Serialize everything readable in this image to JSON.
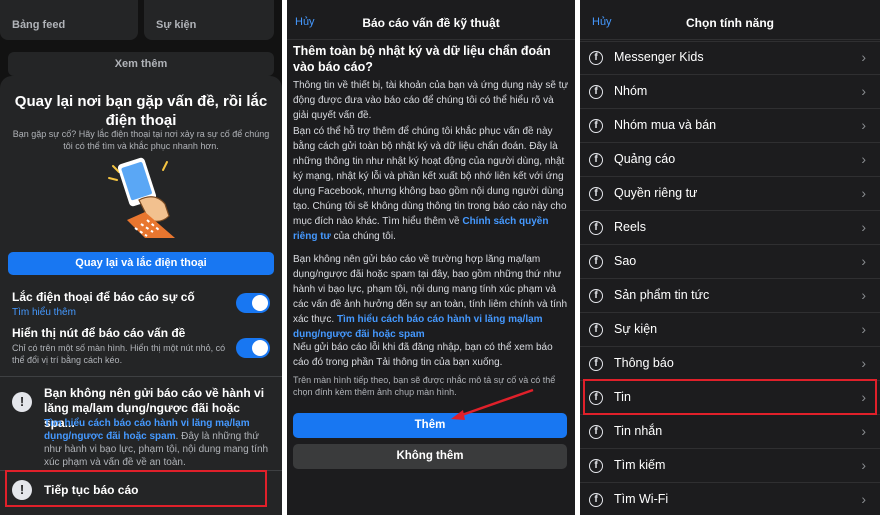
{
  "panel1": {
    "bg_tiles": [
      "Bảng feed",
      "Sự kiện"
    ],
    "bg_see_more": "Xem thêm",
    "title": "Quay lại nơi bạn gặp vấn đề, rồi lắc điện thoại",
    "subtitle": "Bạn gặp sự cố? Hãy lắc điện thoại tại nơi xảy ra sự cố để chúng tôi có thể tìm và khắc phục nhanh hơn.",
    "shake_button": "Quay lại và lắc điện thoại",
    "toggle1": {
      "label": "Lắc điện thoại để báo cáo sự cố",
      "link": "Tìm hiểu thêm",
      "on": true
    },
    "toggle2": {
      "label": "Hiển thị nút để báo cáo vấn đề",
      "desc": "Chỉ có trên một số màn hình. Hiển thị một nút nhỏ, có thể đổi vị trí bằng cách kéo.",
      "on": true
    },
    "warning": {
      "title": "Bạn không nên gửi báo cáo về hành vi lăng mạ/lạm dụng/ngược đãi hoặc spa...",
      "link": "Tìm hiểu cách báo cáo hành vi lăng mạ/lạm dụng/ngược đãi hoặc spam",
      "body": ". Đây là những thứ như hành vi bạo lực, phạm tội, nội dung mang tính xúc phạm và vấn đề về an toàn."
    },
    "continue_label": "Tiếp tục báo cáo"
  },
  "panel2": {
    "cancel": "Hủy",
    "title": "Báo cáo vấn đề kỹ thuật",
    "heading": "Thêm toàn bộ nhật ký và dữ liệu chẩn đoán vào báo cáo?",
    "para1": "Thông tin về thiết bị, tài khoản của bạn và ứng dụng này sẽ tự động được đưa vào báo cáo để chúng tôi có thể hiểu rõ và giải quyết vấn đề.",
    "para2": "Bạn có thể hỗ trợ thêm để chúng tôi khắc phục vấn đề này bằng cách gửi toàn bộ nhật ký và dữ liệu chẩn đoán. Đây là những thông tin như nhật ký hoạt động của người dùng, nhật ký mạng, nhật ký lỗi và phần kết xuất bộ nhớ liên kết với ứng dụng Facebook, nhưng không bao gồm nội dung người dùng tạo. Chúng tôi sẽ không dùng thông tin trong báo cáo này cho mục đích nào khác. Tìm hiểu thêm về",
    "para2_link": "Chính sách quyền riêng tư",
    "para2_end": "của chúng tôi.",
    "para3": "Bạn không nên gửi báo cáo về trường hợp lăng mạ/lạm dụng/ngược đãi hoặc spam tại đây, bao gồm những thứ như hành vi bạo lực, phạm tội, nội dung mang tính xúc phạm và các vấn đề ảnh hưởng đến sự an toàn, tính liêm chính và tính xác thực.",
    "para3_link": "Tìm hiểu cách báo cáo hành vi lăng mạ/lạm dụng/ngược đãi hoặc spam",
    "para4": "Nếu gửi báo cáo lỗi khi đã đăng nhập, bạn có thể xem báo cáo đó trong phần Tải thông tin của bạn xuống.",
    "small": "Trên màn hình tiếp theo, bạn sẽ được nhắc mô tả sự cố và có thể chọn đính kèm thêm ảnh chụp màn hình.",
    "add_button": "Thêm",
    "no_add_button": "Không thêm"
  },
  "panel3": {
    "cancel": "Hủy",
    "title": "Chọn tính năng",
    "items": [
      "Messenger Kids",
      "Nhóm",
      "Nhóm mua và bán",
      "Quảng cáo",
      "Quyền riêng tư",
      "Reels",
      "Sao",
      "Sản phẩm tin tức",
      "Sự kiện",
      "Thông báo",
      "Tin",
      "Tin nhắn",
      "Tìm kiếm",
      "Tìm Wi-Fi"
    ],
    "highlighted": "Tin"
  },
  "colors": {
    "accent": "#1877f2",
    "link": "#4599ff",
    "highlight": "#e0202a"
  },
  "icons": [
    "alert-circle-icon",
    "facebook-circle-icon",
    "chevron-right-icon",
    "phone-shake-illustration",
    "arrow-annotation"
  ]
}
